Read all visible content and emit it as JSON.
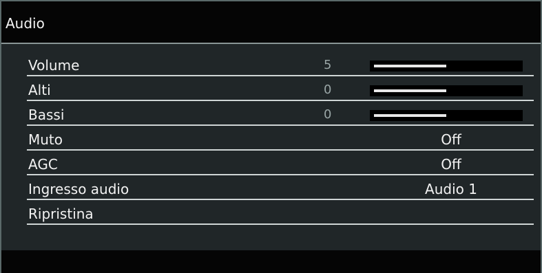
{
  "menu": {
    "title": "Audio",
    "items": [
      {
        "label": "Volume",
        "number": "5",
        "level": 0.5
      },
      {
        "label": "Alti",
        "number": "0",
        "level": 0.5
      },
      {
        "label": "Bassi",
        "number": "0",
        "level": 0.5
      },
      {
        "label": "Muto",
        "value": "Off"
      },
      {
        "label": "AGC",
        "value": "Off"
      },
      {
        "label": "Ingresso audio",
        "value": "Audio 1"
      },
      {
        "label": "Ripristina"
      }
    ]
  },
  "colors": {
    "background": "#202628",
    "title_bar": "#050505",
    "text": "#f2f2f2",
    "slider_track": "#000000",
    "slider_fill": "#e8e8e8",
    "number_text": "#9aa6a6"
  }
}
